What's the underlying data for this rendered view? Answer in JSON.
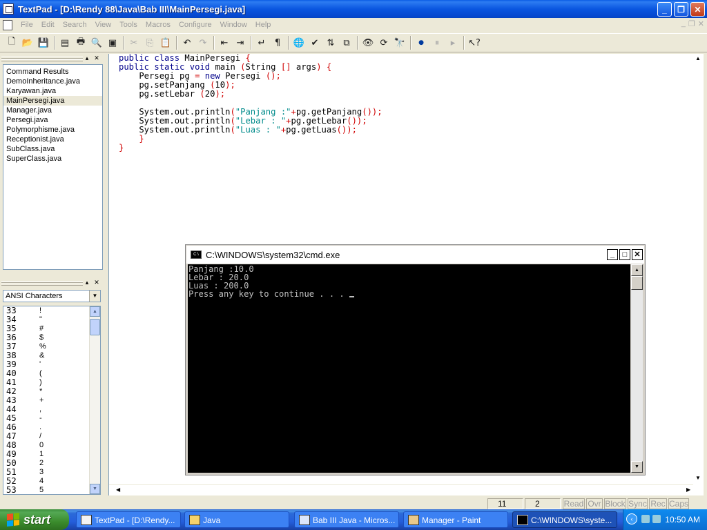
{
  "window": {
    "title": "TextPad - [D:\\Rendy 88\\Java\\Bab III\\MainPersegi.java]"
  },
  "menu": [
    "File",
    "Edit",
    "Search",
    "View",
    "Tools",
    "Macros",
    "Configure",
    "Window",
    "Help"
  ],
  "file_list": [
    {
      "name": "Command Results"
    },
    {
      "name": "DemoInheritance.java"
    },
    {
      "name": "Karyawan.java"
    },
    {
      "name": "MainPersegi.java",
      "selected": true
    },
    {
      "name": "Manager.java"
    },
    {
      "name": "Persegi.java"
    },
    {
      "name": "Polymorphisme.java"
    },
    {
      "name": "Receptionist.java"
    },
    {
      "name": "SubClass.java"
    },
    {
      "name": "SuperClass.java"
    }
  ],
  "ansi_panel": {
    "selected": "ANSI Characters",
    "rows": [
      {
        "code": "33",
        "ch": "!"
      },
      {
        "code": "34",
        "ch": "\""
      },
      {
        "code": "35",
        "ch": "#"
      },
      {
        "code": "36",
        "ch": "$"
      },
      {
        "code": "37",
        "ch": "%"
      },
      {
        "code": "38",
        "ch": "&"
      },
      {
        "code": "39",
        "ch": "'"
      },
      {
        "code": "40",
        "ch": "("
      },
      {
        "code": "41",
        "ch": ")"
      },
      {
        "code": "42",
        "ch": "*"
      },
      {
        "code": "43",
        "ch": "+"
      },
      {
        "code": "44",
        "ch": ","
      },
      {
        "code": "45",
        "ch": "-"
      },
      {
        "code": "46",
        "ch": "."
      },
      {
        "code": "47",
        "ch": "/"
      },
      {
        "code": "48",
        "ch": "0"
      },
      {
        "code": "49",
        "ch": "1"
      },
      {
        "code": "50",
        "ch": "2"
      },
      {
        "code": "51",
        "ch": "3"
      },
      {
        "code": "52",
        "ch": "4"
      },
      {
        "code": "53",
        "ch": "5"
      }
    ]
  },
  "editor": {
    "lines": [
      "public class MainPersegi {",
      "public static void main (String [] args) {",
      "    Persegi pg = new Persegi ();",
      "    pg.setPanjang (10);",
      "    pg.setLebar (20);",
      "",
      "    System.out.println(\"Panjang :\"+pg.getPanjang());",
      "    System.out.println(\"Lebar : \"+pg.getLebar());",
      "    System.out.println(\"Luas : \"+pg.getLuas());",
      "    }",
      "}"
    ]
  },
  "status": {
    "line": "11",
    "col": "2",
    "flags": [
      "Read",
      "Ovr",
      "Block",
      "Sync",
      "Rec",
      "Caps"
    ]
  },
  "cmd": {
    "title": "C:\\WINDOWS\\system32\\cmd.exe",
    "lines": [
      "Panjang :10.0",
      "Lebar : 20.0",
      "Luas : 200.0",
      "Press any key to continue . . . "
    ]
  },
  "taskbar": {
    "start_label": "start",
    "tasks": [
      "TextPad - [D:\\Rendy...",
      "Java",
      "Bab III Java - Micros...",
      "Manager - Paint",
      "C:\\WINDOWS\\syste..."
    ],
    "clock": "10:50 AM"
  },
  "colors": {
    "keyword": "#00008b",
    "string": "#008b8b",
    "punct": "#d00000",
    "titlebar": "#0a56e0"
  }
}
